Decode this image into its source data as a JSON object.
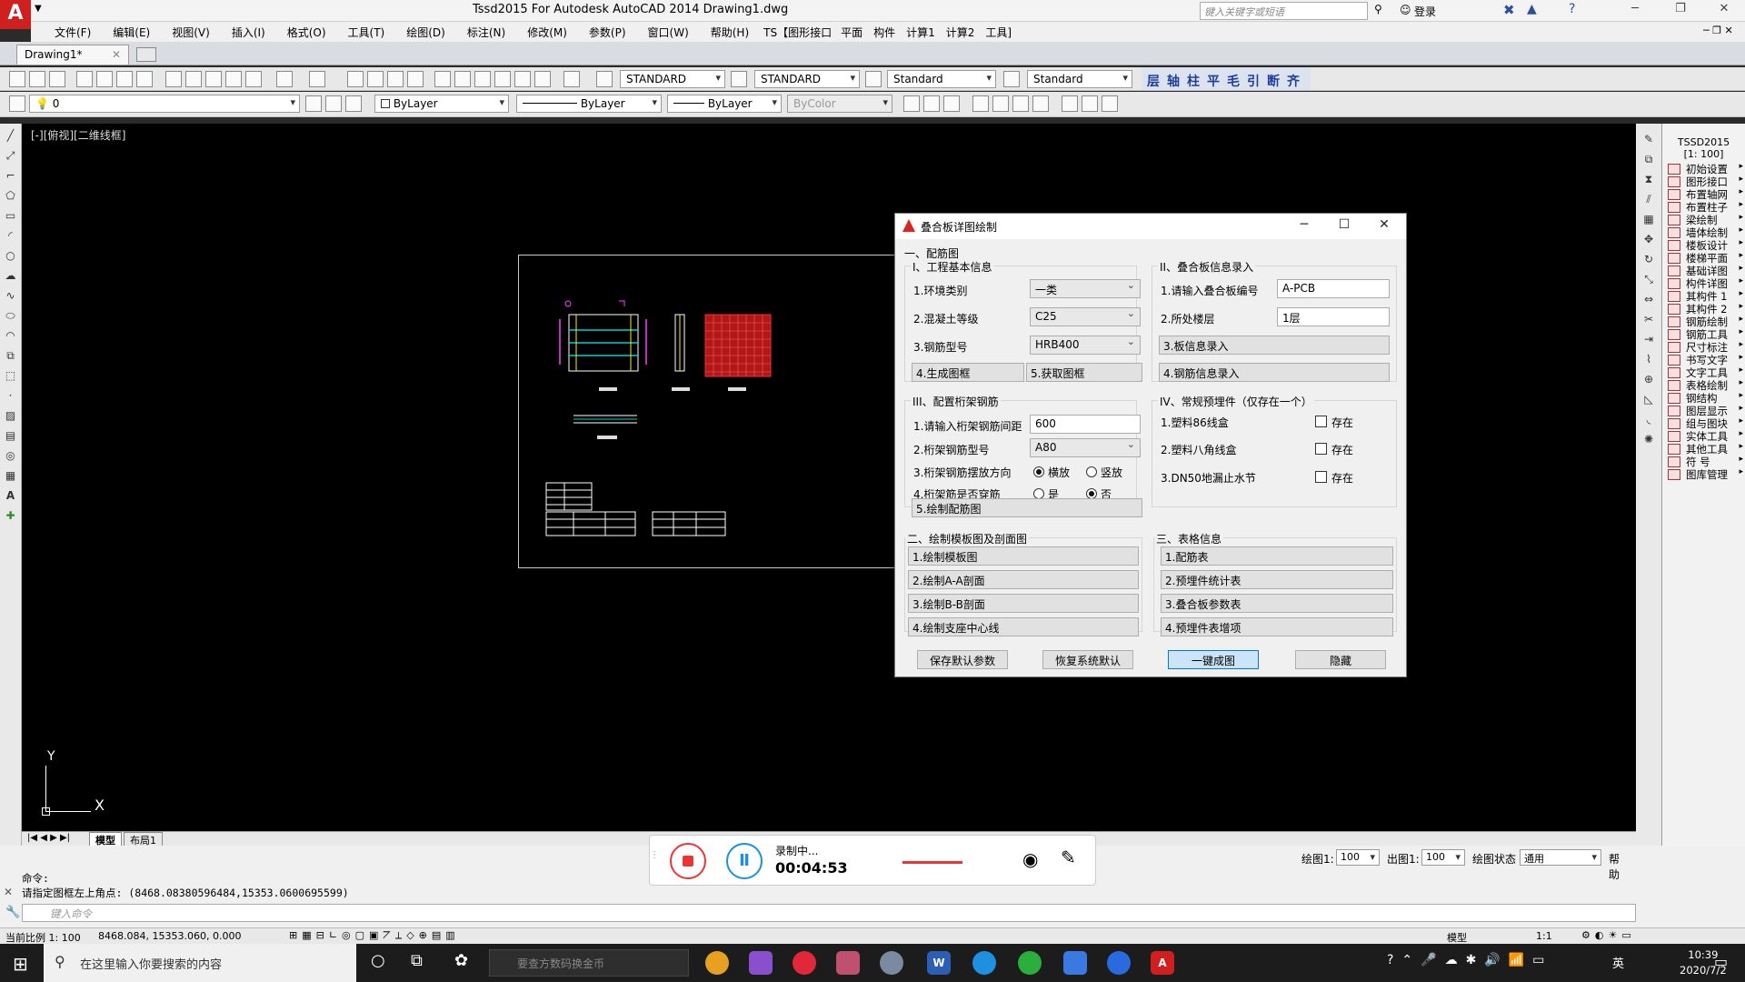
{
  "titlebar": {
    "title": "Tssd2015 For Autodesk AutoCAD 2014    Drawing1.dwg",
    "search_placeholder": "键入关键字或短语",
    "login": "登录"
  },
  "menu": [
    "文件(F)",
    "编辑(E)",
    "视图(V)",
    "插入(I)",
    "格式(O)",
    "工具(T)",
    "绘图(D)",
    "标注(N)",
    "修改(M)",
    "参数(P)",
    "窗口(W)",
    "帮助(H)",
    "TS【图形接口",
    "平面",
    "构件",
    "计算1",
    "计算2",
    "工具]"
  ],
  "doc_tab": "Drawing1*",
  "toolbar1": {
    "text_style": "STANDARD",
    "dim_style": "STANDARD",
    "table_style": "Standard",
    "mleader_style": "Standard",
    "ts_buttons": [
      "层",
      "轴",
      "柱",
      "平",
      "毛",
      "引",
      "断",
      "齐"
    ]
  },
  "toolbar2": {
    "layer": "0",
    "color": "ByLayer",
    "linetype": "ByLayer",
    "lineweight": "ByLayer",
    "plotstyle": "ByColor"
  },
  "viewport_label": "[-][俯视][二维线框]",
  "ucs": {
    "y": "Y",
    "x": "X"
  },
  "layout_tabs": [
    "模型",
    "布局1"
  ],
  "tssd_panel": {
    "header": "TSSD2015",
    "scale": "[1: 100]",
    "items": [
      "初始设置",
      "图形接口",
      "布置轴网",
      "布置柱子",
      "梁绘制",
      "墙体绘制",
      "楼板设计",
      "楼梯平面",
      "基础详图",
      "构件详图",
      "其构件 1",
      "其构件 2",
      "钢筋绘制",
      "钢筋工具",
      "尺寸标注",
      "书写文字",
      "文字工具",
      "表格绘制",
      "钢结构",
      "图层显示",
      "组与图块",
      "实体工具",
      "其他工具",
      "符 号",
      "图库管理"
    ]
  },
  "dialog": {
    "title": "叠合板详图绘制",
    "section_one": "一、配筋图",
    "group_i": {
      "title": "I、工程基本信息",
      "env_label": "1.环境类别",
      "env_value": "一类",
      "concrete_label": "2.混凝土等级",
      "concrete_value": "C25",
      "rebar_label": "3.钢筋型号",
      "rebar_value": "HRB400",
      "btn_gen_frame": "4.生成图框",
      "btn_get_frame": "5.获取图框"
    },
    "group_ii": {
      "title": "II、叠合板信息录入",
      "number_label": "1.请输入叠合板编号",
      "number_value": "A-PCB",
      "floor_label": "2.所处楼层",
      "floor_value": "1层",
      "btn_board_info": "3.板信息录入",
      "btn_rebar_info": "4.钢筋信息录入"
    },
    "group_iii": {
      "title": "III、配置桁架钢筋",
      "spacing_label": "1.请输入桁架钢筋间距",
      "spacing_value": "600",
      "type_label": "2.桁架钢筋型号",
      "type_value": "A80",
      "direction_label": "3.桁架钢筋摆放方向",
      "dir_opt1": "横放",
      "dir_opt2": "竖放",
      "through_label": "4.桁架筋是否穿筋",
      "through_opt1": "是",
      "through_opt2": "否",
      "btn_draw": "5.绘制配筋图"
    },
    "group_iv": {
      "title": "IV、常规预埋件（仅存在一个）",
      "item1": "1.塑料86线盒",
      "item2": "2.塑料八角线盒",
      "item3": "3.DN50地漏止水节",
      "exists": "存在"
    },
    "group_two": {
      "title": "二、绘制模板图及剖面图",
      "buttons": [
        "1.绘制模板图",
        "2.绘制A-A剖面",
        "3.绘制B-B剖面",
        "4.绘制支座中心线"
      ]
    },
    "group_three": {
      "title": "三、表格信息",
      "buttons": [
        "1.配筋表",
        "2.预埋件统计表",
        "3.叠合板参数表",
        "4.预埋件表增项"
      ]
    },
    "footer": {
      "save": "保存默认参数",
      "restore": "恢复系统默认",
      "oneclick": "一键成图",
      "hide": "隐藏"
    }
  },
  "recorder": {
    "status": "录制中...",
    "time": "00:04:53"
  },
  "bottom_right": {
    "draw_label": "绘图1:",
    "draw_value": "100",
    "out_label": "出图1:",
    "out_value": "100",
    "state_label": "绘图状态",
    "state_value": "通用",
    "help": "帮助"
  },
  "command": {
    "line1": "命令:",
    "line2": "请指定图框左上角点: (8468.08380596484,15353.0600695599)",
    "placeholder": "键入命令"
  },
  "status": {
    "scale": "当前比例 1: 100",
    "coords": "8468.084,  15353.060,  0.000",
    "model": "模型",
    "annoscale": "1:1"
  },
  "taskbar": {
    "search": "在这里输入你要搜索的内容",
    "browser_placeholder": "要查方数码换金币",
    "time": "10:39",
    "date": "2020/7/2",
    "ime": "英"
  },
  "colors": {
    "autocad_red": "#cf1f1f",
    "canvas": "#000000",
    "drawing_red": "#e02020",
    "drawing_cyan": "#00d0d0",
    "drawing_magenta": "#ff40ff",
    "drawing_yellow": "#ffee00",
    "oneclick_button": "#cce4f7"
  }
}
